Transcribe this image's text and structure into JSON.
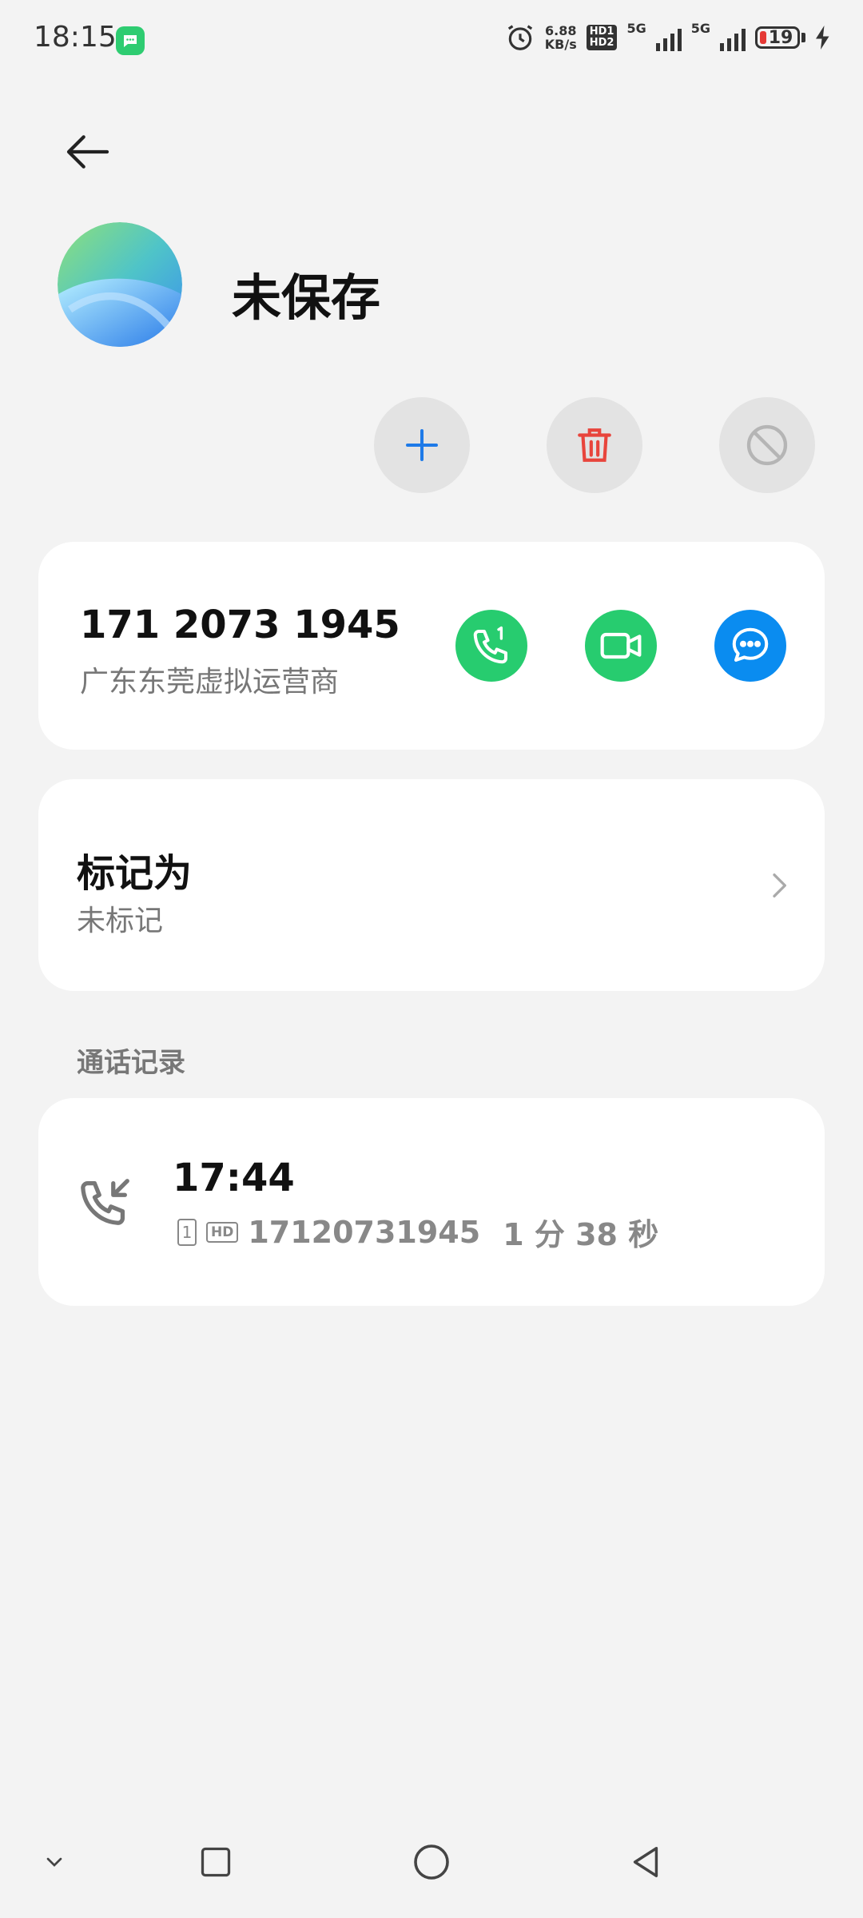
{
  "status_bar": {
    "time": "18:15",
    "net_speed_value": "6.88",
    "net_speed_unit": "KB/s",
    "hd_badge_top": "HD1",
    "hd_badge_bottom": "HD2",
    "network_1": "5G",
    "network_2": "5G",
    "battery_level": "19",
    "accent_green": "#2ecc71"
  },
  "header": {
    "back_icon": "arrow-left-icon",
    "contact_name": "未保存"
  },
  "quick_actions": {
    "add_icon": "plus-icon",
    "delete_icon": "trash-icon",
    "block_icon": "block-icon"
  },
  "phone_card": {
    "number": "171 2073 1945",
    "location": "广东东莞虚拟运营商",
    "call_icon": "phone-sim1-icon",
    "video_icon": "video-call-icon",
    "message_icon": "message-icon",
    "call_color": "#27cc6f",
    "message_color": "#0a8cf0"
  },
  "mark_card": {
    "title": "标记为",
    "value": "未标记"
  },
  "call_log": {
    "section_title": "通话记录",
    "entries": [
      {
        "time": "17:44",
        "sim": "1",
        "hd": "HD",
        "number": "17120731945",
        "duration": "1 分 38 秒",
        "type_icon": "incoming-call-icon"
      }
    ]
  },
  "nav_bar": {
    "icons": [
      "chevron-down-icon",
      "recents-square-icon",
      "home-circle-icon",
      "back-triangle-icon"
    ]
  }
}
